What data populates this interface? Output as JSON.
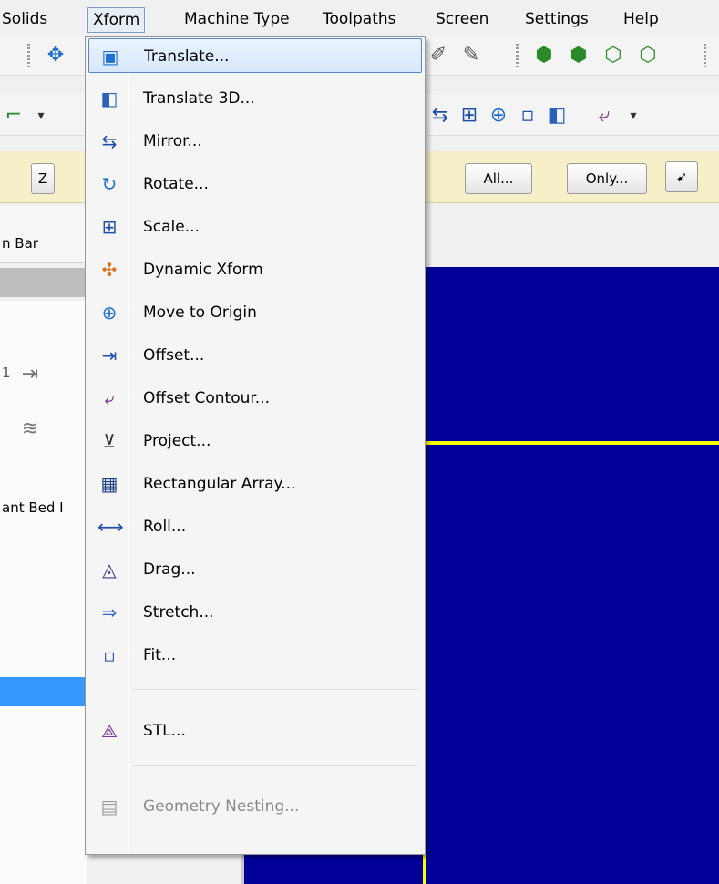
{
  "menubar": {
    "items": [
      "Solids",
      "Xform",
      "Machine Type",
      "Toolpaths",
      "Screen",
      "Settings",
      "Help"
    ]
  },
  "toolbar3": {
    "z_button": "Z",
    "all_button": "All...",
    "only_button": "Only..."
  },
  "left_panel": {
    "bar_label": "n Bar",
    "bed_label": "ant Bed I",
    "number_text": "1"
  },
  "xform_menu": {
    "items": [
      {
        "label": "Translate...",
        "icon": "translate-icon",
        "color": "#1f6fd1",
        "glyph": "▣"
      },
      {
        "label": "Translate 3D...",
        "icon": "translate-3d-icon",
        "color": "#2b5fb8",
        "glyph": "◧"
      },
      {
        "label": "Mirror...",
        "icon": "mirror-icon",
        "color": "#1f4fa8",
        "glyph": "⇆"
      },
      {
        "label": "Rotate...",
        "icon": "rotate-icon",
        "color": "#1f6fd1",
        "glyph": "↻"
      },
      {
        "label": "Scale...",
        "icon": "scale-icon",
        "color": "#1f4fa8",
        "glyph": "⊞"
      },
      {
        "label": "Dynamic Xform",
        "icon": "dynamic-xform-icon",
        "color": "#e07020",
        "glyph": "✣"
      },
      {
        "label": "Move to Origin",
        "icon": "move-to-origin-icon",
        "color": "#1f6fd1",
        "glyph": "⊕"
      },
      {
        "label": "Offset...",
        "icon": "offset-icon",
        "color": "#1f4fa8",
        "glyph": "⇥"
      },
      {
        "label": "Offset Contour...",
        "icon": "offset-contour-icon",
        "color": "#7a2a8a",
        "glyph": "⤶"
      },
      {
        "label": "Project...",
        "icon": "project-icon",
        "color": "#2a2a2a",
        "glyph": "⊻"
      },
      {
        "label": "Rectangular Array...",
        "icon": "rectangular-array-icon",
        "color": "#1f3f88",
        "glyph": "▦"
      },
      {
        "label": "Roll...",
        "icon": "roll-icon",
        "color": "#1f4fa8",
        "glyph": "⟷"
      },
      {
        "label": "Drag...",
        "icon": "drag-icon",
        "color": "#3a3a8a",
        "glyph": "◬"
      },
      {
        "label": "Stretch...",
        "icon": "stretch-icon",
        "color": "#3a6ac8",
        "glyph": "⇒"
      },
      {
        "label": "Fit...",
        "icon": "fit-icon",
        "color": "#1f4fa8",
        "glyph": "▫"
      },
      {
        "label": "STL...",
        "icon": "stl-icon",
        "color": "#7a3a9a",
        "glyph": "⟁"
      },
      {
        "label": "Geometry Nesting...",
        "icon": "geometry-nesting-icon",
        "color": "#9a9a9a",
        "glyph": "▤"
      }
    ]
  },
  "colors": {
    "viewport_bg": "#000099",
    "viewport_line": "#ffff00",
    "selection": "#3399ff"
  }
}
